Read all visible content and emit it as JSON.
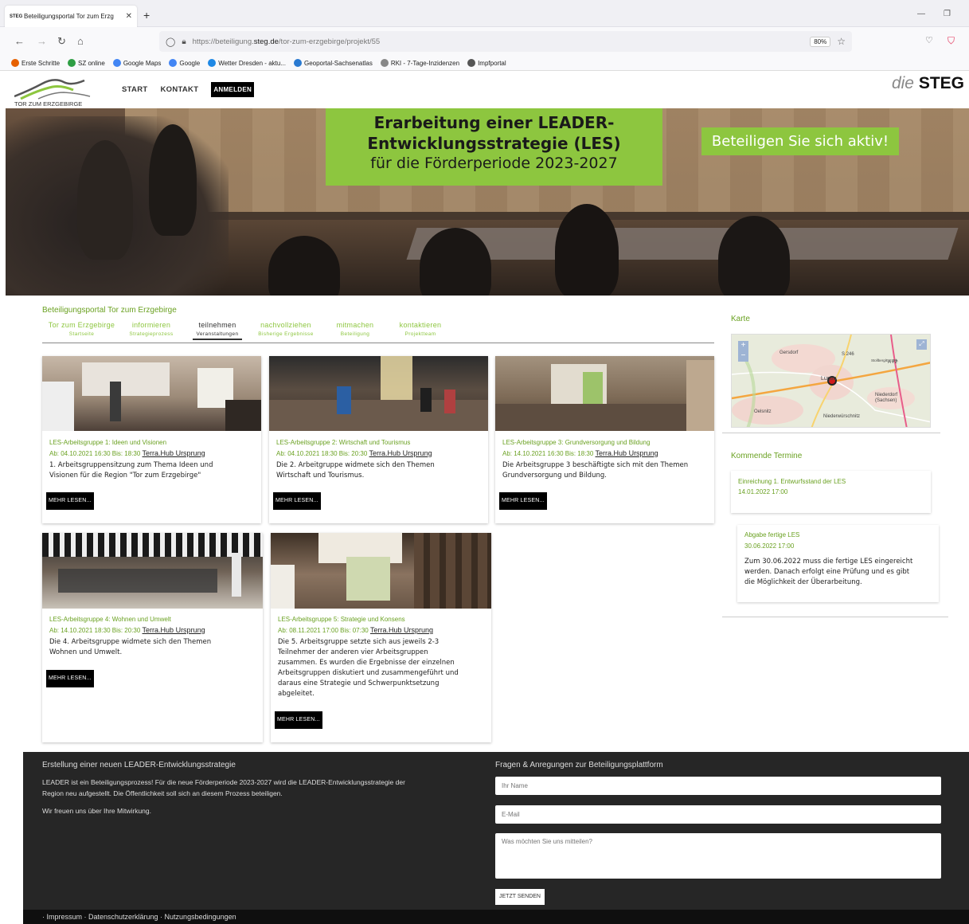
{
  "browser": {
    "tab_title": "Beteiligungsportal Tor zum Erzg",
    "tab_favicon": "STEG",
    "url_prefix": "https://beteiligung.",
    "url_domain": "steg.de",
    "url_path": "/tor-zum-erzgebirge/projekt/55",
    "zoom": "80%",
    "bookmarks": [
      {
        "label": "Erste Schritte",
        "icon": "firefox-icon",
        "color": "#e66000"
      },
      {
        "label": "SZ online",
        "icon": "sz-icon",
        "color": "#2e9e44"
      },
      {
        "label": "Google Maps",
        "icon": "google-icon",
        "color": "#4285f4"
      },
      {
        "label": "Google",
        "icon": "google-icon",
        "color": "#4285f4"
      },
      {
        "label": "Wetter Dresden - aktu...",
        "icon": "weather-icon",
        "color": "#1e88e5"
      },
      {
        "label": "Geoportal-Sachsenatlas",
        "icon": "geoportal-icon",
        "color": "#2a7ad1"
      },
      {
        "label": "RKI - 7-Tage-Inzidenzen",
        "icon": "rki-icon",
        "color": "#888888"
      },
      {
        "label": "Impfportal",
        "icon": "globe-icon",
        "color": "#555555"
      }
    ]
  },
  "header": {
    "logo_text": "TOR ZUM ERZGEBIRGE",
    "nav": [
      "START",
      "KONTAKT"
    ],
    "login": "ANMELDEN",
    "brand_die": "die",
    "brand_steg": "STEG"
  },
  "hero": {
    "line1": "Erarbeitung einer LEADER-",
    "line2": "Entwicklungsstrategie (LES)",
    "line3": "für die Förderperiode 2023-2027",
    "cta": "Beteiligen Sie sich aktiv!"
  },
  "portal": {
    "title": "Beteiligungsportal Tor zum Erzgebirge",
    "tabs": [
      {
        "top": "Tor zum Erzgebirge",
        "sub": "Startseite"
      },
      {
        "top": "informieren",
        "sub": "Strategieprozess"
      },
      {
        "top": "teilnehmen",
        "sub": "Veranstaltungen"
      },
      {
        "top": "nachvollziehen",
        "sub": "Bisherige Ergebnisse"
      },
      {
        "top": "mitmachen",
        "sub": "Beteiligung"
      },
      {
        "top": "kontaktieren",
        "sub": "Projektteam"
      }
    ]
  },
  "cards": [
    {
      "title": "LES-Arbeitsgruppe 1: Ideen und Visionen",
      "date": "Ab: 04.10.2021 16:30 Bis: 18:30",
      "location": "Terra.Hub Ursprung",
      "desc": [
        "1. Arbeitsgruppensitzung zum Thema Ideen und",
        "Visionen für die Region \"Tor zum Erzgebirge\""
      ],
      "more": "MEHR LESEN..."
    },
    {
      "title": "LES-Arbeitsgruppe 2: Wirtschaft und Tourismus",
      "date": "Ab: 04.10.2021 18:30 Bis: 20:30",
      "location": "Terra.Hub Ursprung",
      "desc": [
        "Die 2. Arbeitgruppe widmete sich den Themen",
        "Wirtschaft und Tourismus."
      ],
      "more": "MEHR LESEN..."
    },
    {
      "title": "LES-Arbeitsgruppe 3: Grundversorgung und Bildung",
      "date": "Ab: 14.10.2021 16:30 Bis: 18:30",
      "location": "Terra.Hub Ursprung",
      "desc": [
        "Die Arbeitsgruppe 3 beschäftigte sich mit den Themen",
        "Grundversorgung und Bildung."
      ],
      "more": "MEHR LESEN..."
    },
    {
      "title": "LES-Arbeitsgruppe 4: Wohnen und Umwelt",
      "date": "Ab: 14.10.2021 18:30 Bis: 20:30",
      "location": "Terra.Hub Ursprung",
      "desc": [
        "Die 4. Arbeitsgruppe widmete sich den Themen",
        "Wohnen und Umwelt."
      ],
      "more": "MEHR LESEN..."
    },
    {
      "title": "LES-Arbeitsgruppe 5: Strategie und Konsens",
      "date": "Ab: 08.11.2021 17:00 Bis: 07:30",
      "location": "Terra.Hub Ursprung",
      "desc": [
        "Die 5. Arbeitsgruppe setzte sich aus jeweils 2-3",
        "Teilnehmer der anderen vier Arbeitsgruppen",
        "zusammen. Es wurden die Ergebnisse der einzelnen",
        "Arbeitsgruppen diskutiert und zusammengeführt und",
        "daraus eine Strategie und Schwerpunktsetzung",
        "abgeleitet."
      ],
      "more": "MEHR LESEN..."
    }
  ],
  "sidebar": {
    "map_title": "Karte",
    "map_labels": [
      "Gersdorf",
      "S 246",
      "Lugau",
      "A 72",
      "Niederdorf (Sachsen)",
      "Oelsnitz",
      "Niederwürschnitz",
      "Stollberg/Erzgeb."
    ],
    "events_title": "Kommende Termine",
    "events": [
      {
        "title": "Einreichung 1. Entwurfsstand der LES",
        "date": "14.01.2022 17:00",
        "desc": []
      },
      {
        "title": "Abgabe fertige LES",
        "date": "30.06.2022 17:00",
        "desc": [
          "Zum 30.06.2022 muss die fertige LES eingereicht",
          "werden. Danach erfolgt eine Prüfung und es gibt",
          "die Möglichkeit der Überarbeitung."
        ]
      }
    ]
  },
  "footer": {
    "left_title": "Erstellung einer neuen LEADER-Entwicklungsstrategie",
    "left_p1a": "LEADER ist ein Beteiligungsprozess! Für die neue Förderperiode 2023-2027 wird die LEADER-Entwicklungsstrategie der",
    "left_p1b": "Region neu aufgestellt. Die Öffentlichkeit soll sich an diesem Prozess beteiligen.",
    "left_p2": "Wir freuen uns über Ihre Mitwirkung.",
    "right_title": "Fragen & Anregungen zur Beteiligungsplattform",
    "name_placeholder": "Ihr Name",
    "email_placeholder": "E-Mail",
    "msg_placeholder": "Was möchten Sie uns mitteilen?",
    "send": "JETZT SENDEN",
    "links": "· Impressum · Datenschutzerklärung · Nutzungsbedingungen"
  }
}
